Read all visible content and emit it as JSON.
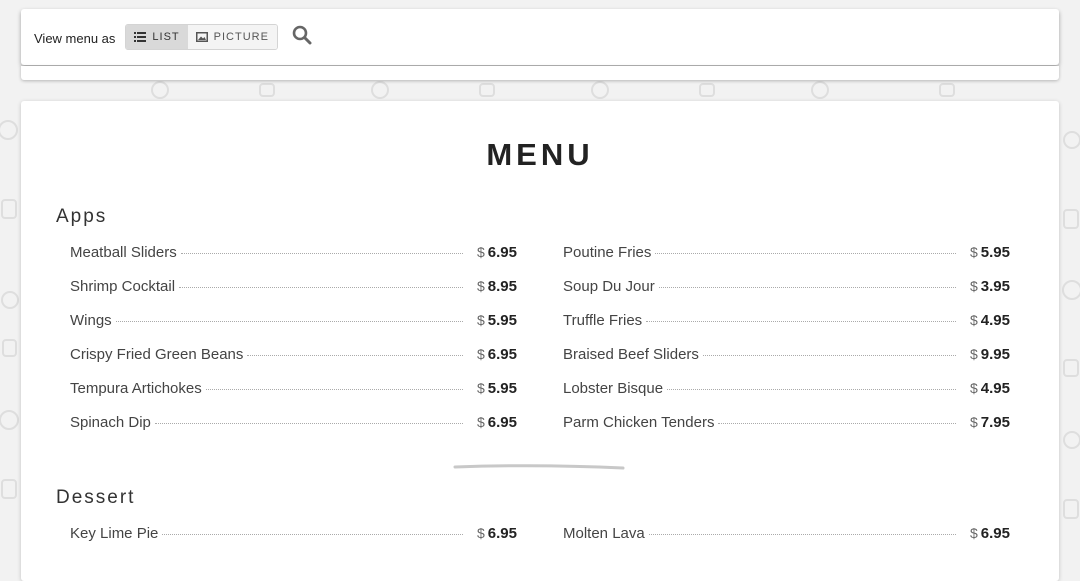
{
  "toolbar": {
    "view_label": "View menu as",
    "list_label": "LIST",
    "picture_label": "PICTURE",
    "list_icon": "list-icon",
    "picture_icon": "image-icon",
    "search_icon": "search-icon"
  },
  "menu": {
    "title": "MENU",
    "sections": [
      {
        "title": "Apps",
        "left": [
          {
            "name": "Meatball Sliders",
            "currency": "$",
            "price": "6.95"
          },
          {
            "name": "Shrimp Cocktail",
            "currency": "$",
            "price": "8.95"
          },
          {
            "name": "Wings",
            "currency": "$",
            "price": "5.95"
          },
          {
            "name": "Crispy Fried Green Beans",
            "currency": "$",
            "price": "6.95"
          },
          {
            "name": "Tempura Artichokes",
            "currency": "$",
            "price": "5.95"
          },
          {
            "name": "Spinach Dip",
            "currency": "$",
            "price": "6.95"
          }
        ],
        "right": [
          {
            "name": "Poutine Fries",
            "currency": "$",
            "price": "5.95"
          },
          {
            "name": "Soup Du Jour",
            "currency": "$",
            "price": "3.95"
          },
          {
            "name": "Truffle Fries",
            "currency": "$",
            "price": "4.95"
          },
          {
            "name": "Braised Beef Sliders",
            "currency": "$",
            "price": "9.95"
          },
          {
            "name": "Lobster Bisque",
            "currency": "$",
            "price": "4.95"
          },
          {
            "name": "Parm Chicken Tenders",
            "currency": "$",
            "price": "7.95"
          }
        ]
      },
      {
        "title": "Dessert",
        "left": [
          {
            "name": "Key Lime Pie",
            "currency": "$",
            "price": "6.95"
          }
        ],
        "right": [
          {
            "name": "Molten Lava",
            "currency": "$",
            "price": "6.95"
          }
        ]
      }
    ]
  },
  "colors": {
    "background": "#f2f2f2",
    "card": "#ffffff",
    "active_toggle": "#d9d9d9",
    "text_dark": "#222222"
  }
}
